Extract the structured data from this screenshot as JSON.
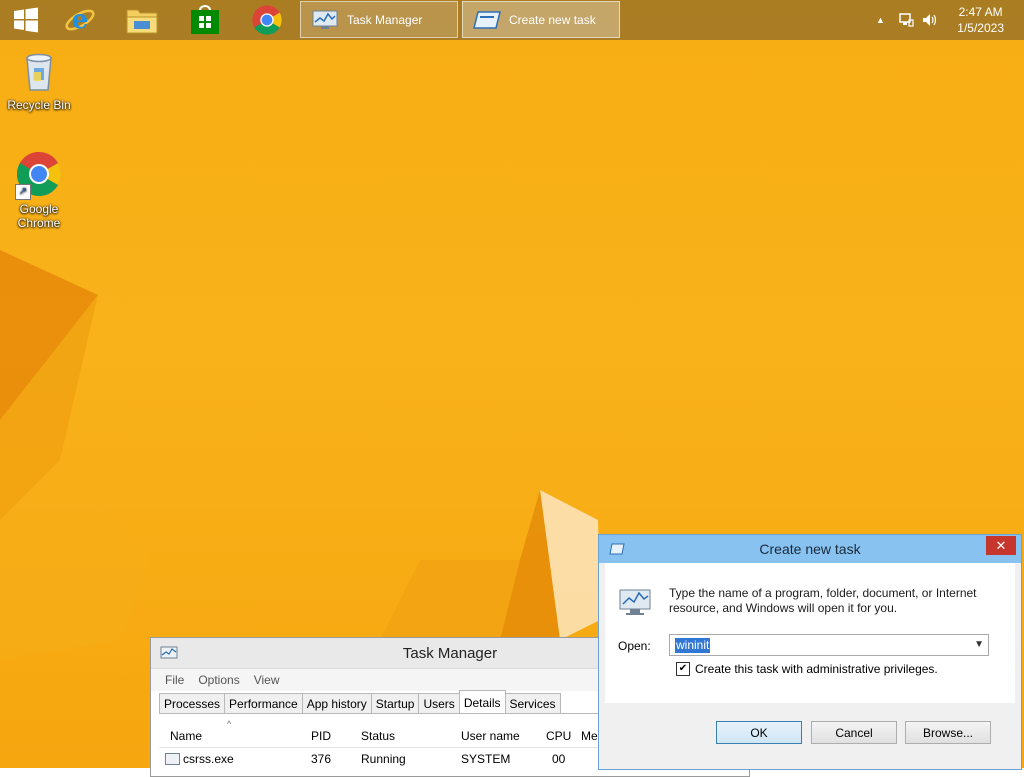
{
  "taskbar": {
    "pinned": [
      {
        "name": "Start"
      },
      {
        "name": "Internet Explorer"
      },
      {
        "name": "File Explorer"
      },
      {
        "name": "Store"
      },
      {
        "name": "Google Chrome"
      }
    ],
    "tasks": [
      {
        "label": "Task Manager"
      },
      {
        "label": "Create new task"
      }
    ],
    "clock": {
      "time": "2:47 AM",
      "date": "1/5/2023"
    }
  },
  "desktop": {
    "icons": [
      {
        "label": "Recycle Bin"
      },
      {
        "label": "Google Chrome"
      }
    ]
  },
  "task_manager": {
    "title": "Task Manager",
    "menu": [
      "File",
      "Options",
      "View"
    ],
    "tabs": [
      "Processes",
      "Performance",
      "App history",
      "Startup",
      "Users",
      "Details",
      "Services"
    ],
    "active_tab": "Details",
    "columns": [
      "Name",
      "PID",
      "Status",
      "User name",
      "CPU",
      "Me"
    ],
    "rows": [
      {
        "name": "csrss.exe",
        "pid": "376",
        "status": "Running",
        "user": "SYSTEM",
        "cpu": "00"
      }
    ]
  },
  "dialog": {
    "title": "Create new task",
    "description": "Type the name of a program, folder, document, or Internet resource, and Windows will open it for you.",
    "open_label": "Open:",
    "open_value": "wininit",
    "admin_checkbox_label": "Create this task with administrative privileges.",
    "admin_checked": true,
    "buttons": {
      "ok": "OK",
      "cancel": "Cancel",
      "browse": "Browse..."
    },
    "close_glyph": "✕"
  },
  "colors": {
    "desktop": "#f9b21a",
    "taskbar": "#967028",
    "dialog_title": "#88c2f0",
    "close": "#c7362d"
  }
}
